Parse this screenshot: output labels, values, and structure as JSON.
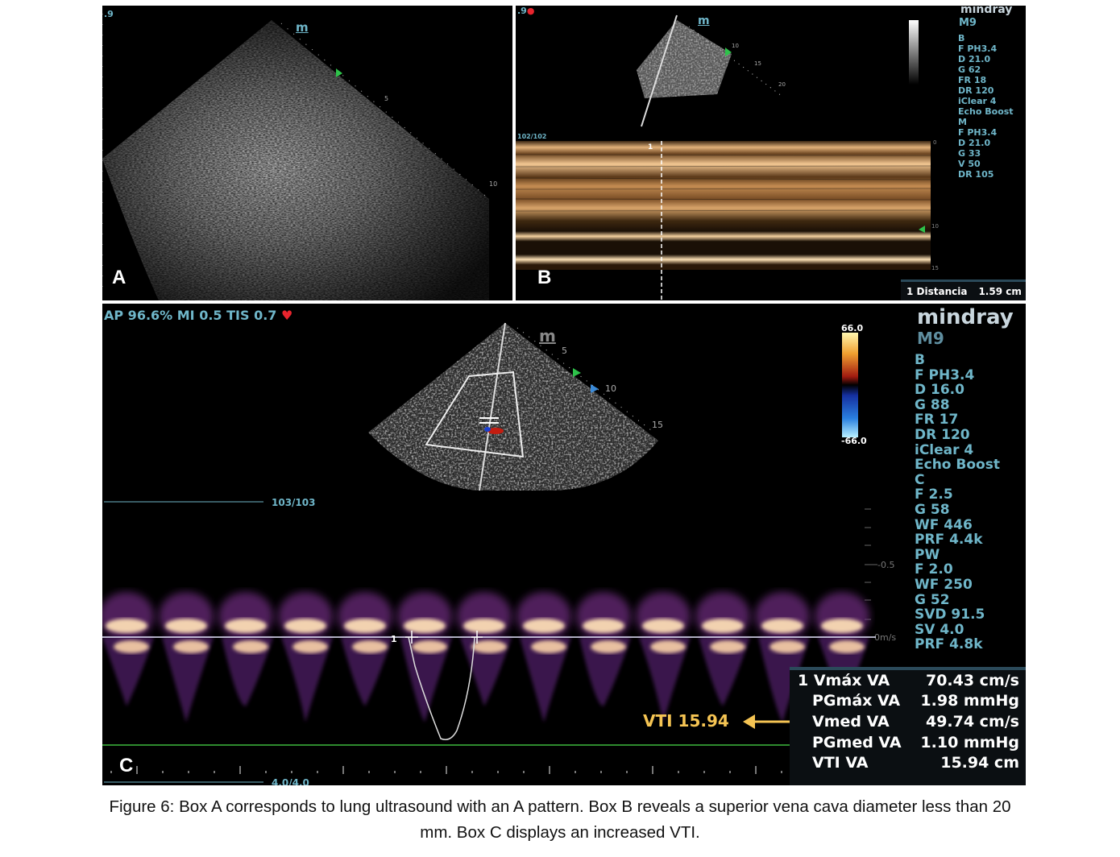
{
  "panel_a": {
    "label": "A",
    "top_left_mark": ".9",
    "probe_mark": "m",
    "depth_ticks": [
      "5",
      "10"
    ]
  },
  "panel_b": {
    "label": "B",
    "top_left_mark": ".9",
    "probe_mark": "m",
    "sector_ticks": [
      "10",
      "15",
      "20"
    ],
    "frame_counter": "102/102",
    "cursor_mark": "1",
    "mmode_scale": [
      "0",
      "10",
      "15"
    ],
    "brand": "mindray",
    "model": "M9",
    "params": [
      "B",
      "F PH3.4",
      "D 21.0",
      "G 62",
      "FR 18",
      "DR 120",
      "iClear 4",
      "Echo Boost",
      "M",
      "F PH3.4",
      "D 21.0",
      "G 33",
      "V 50",
      "DR 105"
    ],
    "measurement_label": "1 Distancia",
    "measurement_value": "1.59 cm"
  },
  "panel_c": {
    "label": "C",
    "header": "AP 96.6%  MI 0.5 TIS 0.7",
    "probe_mark": "m",
    "sector_ticks": [
      "5",
      "10",
      "15"
    ],
    "color_scale_max": "66.0",
    "color_scale_min": "-66.0",
    "frame_counter": "103/103",
    "bottom_counter": "4.0/4.0",
    "doppler_scale_top": "-0.5",
    "doppler_baseline": "0m/s",
    "cursor_mark": "1",
    "brand": "mindray",
    "model": "M9",
    "params": [
      "B",
      "F PH3.4",
      "D 16.0",
      "G 88",
      "FR 17",
      "DR 120",
      "iClear 4",
      "Echo Boost",
      "C",
      "F 2.5",
      "G 58",
      "WF 446",
      "PRF 4.4k",
      "PW",
      "F 2.0",
      "WF 250",
      "G 52",
      "SVD 91.5",
      "SV 4.0",
      "PRF 4.8k"
    ],
    "annotation": "VTI 15.94",
    "measurements": [
      {
        "label": "1 Vmáx VA",
        "value": "70.43 cm/s"
      },
      {
        "label": "PGmáx VA",
        "value": "1.98 mmHg"
      },
      {
        "label": "Vmed VA",
        "value": "49.74 cm/s"
      },
      {
        "label": "PGmed VA",
        "value": "1.10 mmHg"
      },
      {
        "label": "VTI VA",
        "value": "15.94 cm"
      }
    ]
  },
  "caption": {
    "line1": "Figure 6: Box A corresponds to lung ultrasound with an A pattern. Box B reveals a superior vena cava diameter less than 20",
    "line2": "mm. Box C displays an increased VTI."
  },
  "colors": {
    "panel_bg": "#000000",
    "screen_text": "#6fb6c9",
    "annotation": "#f5c453",
    "baseline_green": "#2e8b2e",
    "heart": "#e8242d"
  }
}
